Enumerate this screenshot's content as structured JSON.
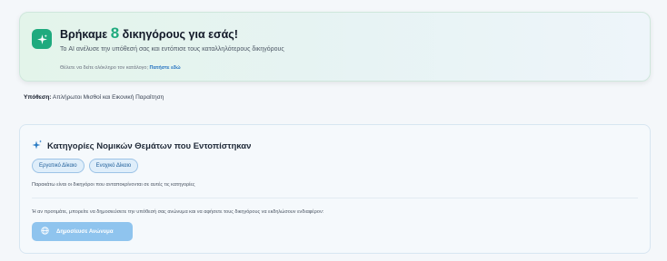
{
  "banner": {
    "title_prefix": "Βρήκαμε",
    "lawyer_count": "8",
    "title_suffix": "δικηγόρους για εσάς!",
    "subtitle": "Το AI ανέλυσε την υπόθεσή σας και εντόπισε τους καταλληλότερους δικηγόρους",
    "catalog_text": "Θέλετε να δείτε ολόκληρο τον κατάλογο;",
    "catalog_link": "Πατήστε εδώ",
    "icon": "sparkle-icon"
  },
  "case": {
    "label": "Υπόθεση:",
    "value": "Απλήρωτοι Μισθοί και Εικονική Παραίτηση"
  },
  "categories": {
    "title": "Κατηγορίες Νομικών Θεμάτων που Εντοπίστηκαν",
    "icon": "sparkle-icon",
    "tags": [
      "Εργατικό Δίκαιο",
      "Ενοχικό Δίκαιο"
    ],
    "description": "Παρακάτω είναι οι δικηγόροι που ανταποκρίνονται σε αυτές τις κατηγορίες",
    "note": "Ή αν προτιμάτε, μπορείτε να δημοσιεύσετε την υπόθεσή σας ανώνυμα και να αφήσετε τους δικηγόρους να εκδηλώσουν ενδιαφέρον:",
    "publish_button": "Δημοσίευσε Ανώνυμα",
    "publish_icon": "globe-icon"
  },
  "colors": {
    "accent_green": "#1faa7e",
    "accent_blue": "#1f6fbf",
    "button_blue": "#8fc4ee"
  }
}
